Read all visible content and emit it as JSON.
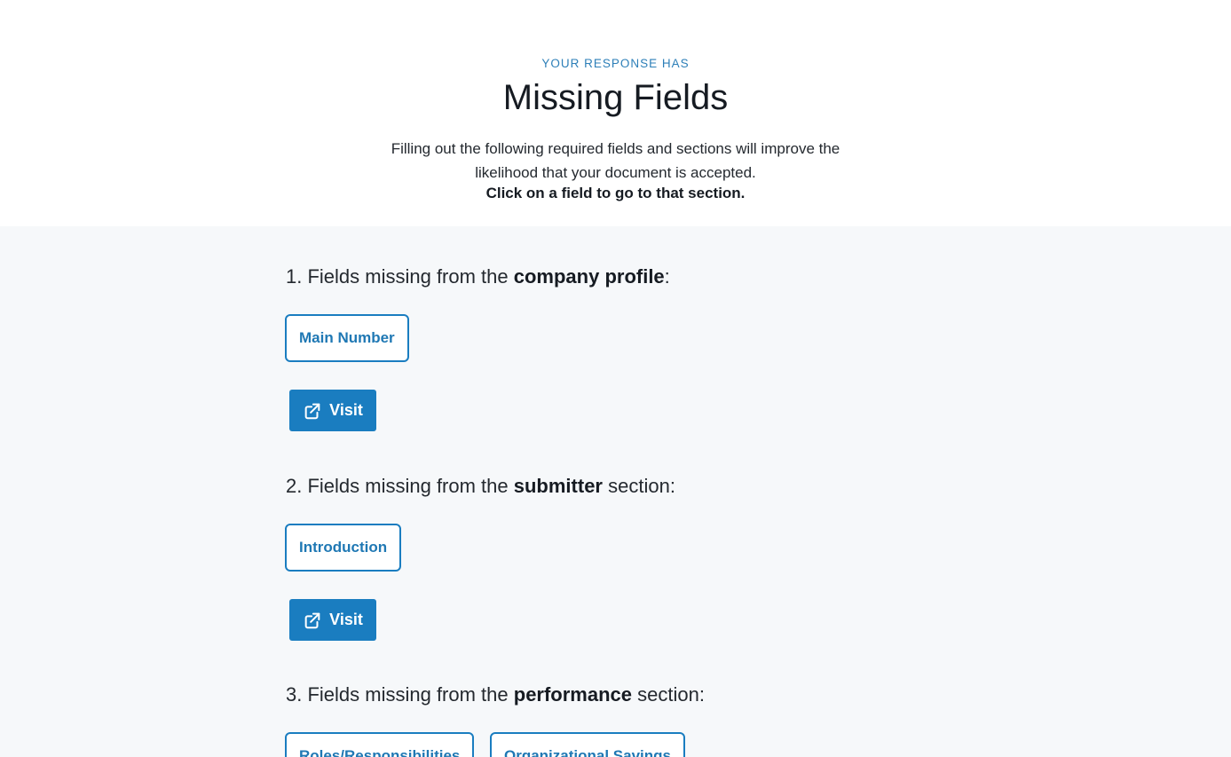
{
  "header": {
    "eyebrow": "YOUR RESPONSE HAS",
    "title": "Missing Fields",
    "description": "Filling out the following required fields and sections will improve the likelihood that your document is accepted.",
    "instruction": "Click on a field to go to that section."
  },
  "sections": [
    {
      "prefix": "1. Fields missing from the ",
      "name": "company profile",
      "suffix": ":",
      "fields": [
        "Main Number"
      ],
      "visit_label": "Visit",
      "visit_icon": "external-link-icon"
    },
    {
      "prefix": "2. Fields missing from the ",
      "name": "submitter",
      "suffix": " section:",
      "fields": [
        "Introduction"
      ],
      "visit_label": "Visit",
      "visit_icon": "external-link-icon"
    },
    {
      "prefix": "3. Fields missing from the ",
      "name": "performance",
      "suffix": " section:",
      "fields": [
        "Roles/Responsibilities",
        "Organizational Savings"
      ]
    }
  ],
  "colors": {
    "accent": "#1a7dc0",
    "background": "#f6f8fa",
    "text": "#161b22"
  }
}
